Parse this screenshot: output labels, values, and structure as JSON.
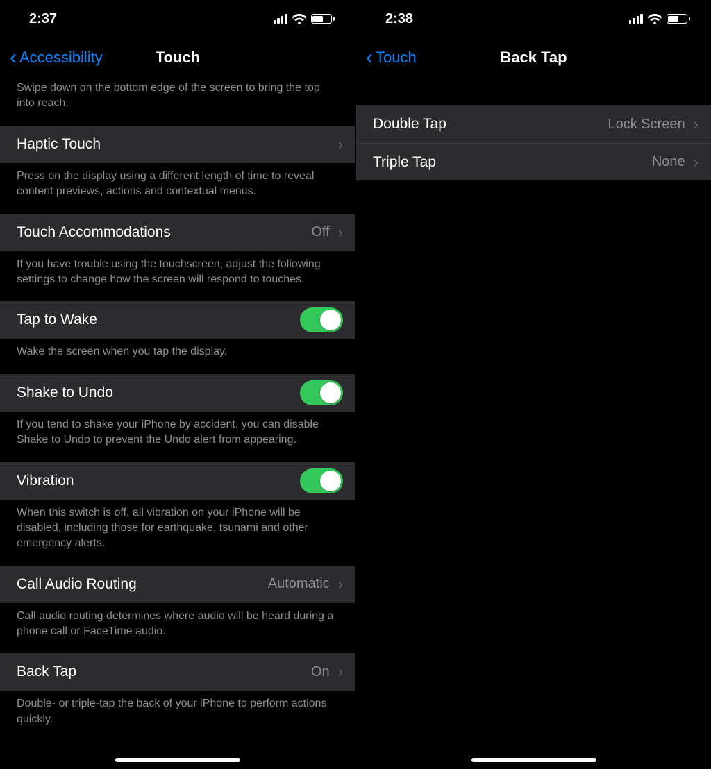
{
  "left": {
    "status": {
      "time": "2:37"
    },
    "nav": {
      "back": "Accessibility",
      "title": "Touch"
    },
    "reachability_footer": "Swipe down on the bottom edge of the screen to bring the top into reach.",
    "haptic": {
      "label": "Haptic Touch"
    },
    "haptic_footer": "Press on the display using a different length of time to reveal content previews, actions and contextual menus.",
    "touch_accom": {
      "label": "Touch Accommodations",
      "value": "Off"
    },
    "touch_accom_footer": "If you have trouble using the touchscreen, adjust the following settings to change how the screen will respond to touches.",
    "tap_wake": {
      "label": "Tap to Wake"
    },
    "tap_wake_footer": "Wake the screen when you tap the display.",
    "shake": {
      "label": "Shake to Undo"
    },
    "shake_footer": "If you tend to shake your iPhone by accident, you can disable Shake to Undo to prevent the Undo alert from appearing.",
    "vibration": {
      "label": "Vibration"
    },
    "vibration_footer": "When this switch is off, all vibration on your iPhone will be disabled, including those for earthquake, tsunami and other emergency alerts.",
    "car": {
      "label": "Call Audio Routing",
      "value": "Automatic"
    },
    "car_footer": "Call audio routing determines where audio will be heard during a phone call or FaceTime audio.",
    "backtap": {
      "label": "Back Tap",
      "value": "On"
    },
    "backtap_footer": "Double- or triple-tap the back of your iPhone to perform actions quickly."
  },
  "right": {
    "status": {
      "time": "2:38"
    },
    "nav": {
      "back": "Touch",
      "title": "Back Tap"
    },
    "double": {
      "label": "Double Tap",
      "value": "Lock Screen"
    },
    "triple": {
      "label": "Triple Tap",
      "value": "None"
    }
  }
}
